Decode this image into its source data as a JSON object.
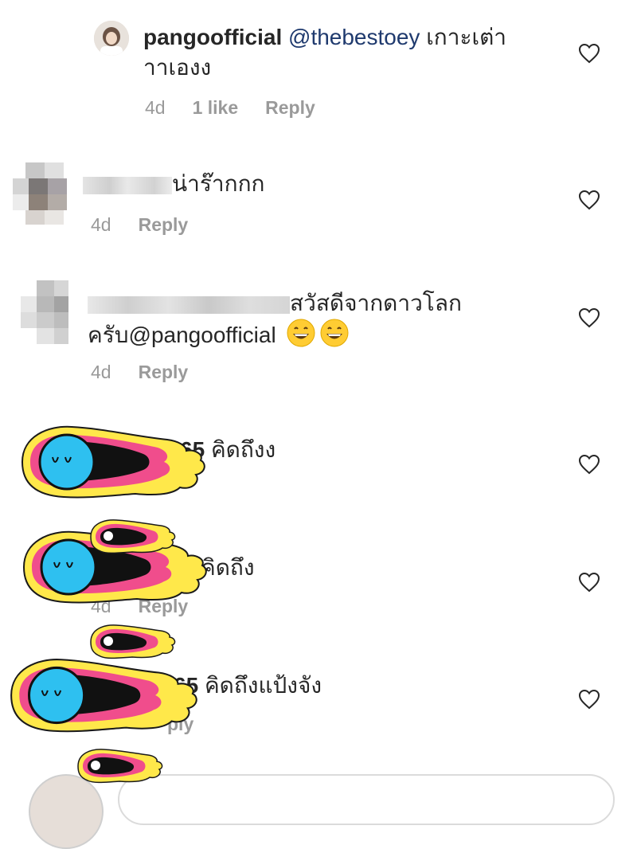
{
  "comments": [
    {
      "username": "pangoofficial",
      "mention": "@thebestoey",
      "text": "เกาะเต่า",
      "text2": "าาเองง",
      "time": "4d",
      "likes": "1 like",
      "reply": "Reply"
    },
    {
      "username": "",
      "text": "น่าร๊ากกก",
      "time": "4d",
      "reply": "Reply"
    },
    {
      "username": "",
      "text": "สวัสดีจากดาวโลก",
      "text2": "ครับ@pangoofficial",
      "time": "4d",
      "reply": "Reply"
    },
    {
      "username_tail": "65",
      "text": "คิดถึงง"
    },
    {
      "text": "คิดถึง",
      "time": "4d",
      "reply": "Reply"
    },
    {
      "username_tail": "65",
      "text": "คิดถึงแป้งจัง",
      "reply_tail": "ply"
    }
  ],
  "icons": {
    "heart": "heart-outline-icon",
    "emoji": "grinning-face-emoji"
  },
  "colors": {
    "mention": "#1f3a6e",
    "meta": "#9a9a9a",
    "sticker_yellow": "#ffe84a",
    "sticker_pink": "#f04d8c",
    "sticker_blue": "#2ec0f0"
  }
}
